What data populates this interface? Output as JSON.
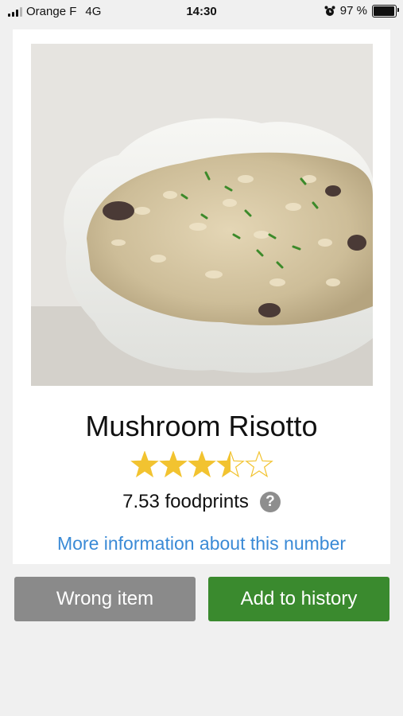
{
  "status_bar": {
    "carrier": "Orange F",
    "network": "4G",
    "time": "14:30",
    "battery_percent": "97 %",
    "battery_level": 0.97,
    "signal_bars_active": 3,
    "signal_bars_total": 4
  },
  "food": {
    "title": "Mushroom Risotto",
    "rating": 3.5,
    "rating_max": 5,
    "star_color": "#f2c330",
    "foodprints_text": "7.53 foodprints",
    "help_symbol": "?",
    "more_info_link": "More information about this number"
  },
  "actions": {
    "wrong_item_label": "Wrong item",
    "add_history_label": "Add to history"
  },
  "colors": {
    "link": "#3a8ad6",
    "add_button": "#3a8a2e",
    "wrong_button": "#8a8a8a",
    "background": "#f0f0f0"
  }
}
